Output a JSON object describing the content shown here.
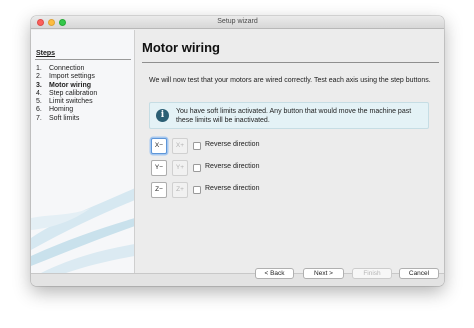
{
  "window": {
    "title": "Setup wizard"
  },
  "sidebar": {
    "heading": "Steps",
    "steps": [
      {
        "num": "1.",
        "label": "Connection",
        "active": false
      },
      {
        "num": "2.",
        "label": "Import settings",
        "active": false
      },
      {
        "num": "3.",
        "label": "Motor wiring",
        "active": true
      },
      {
        "num": "4.",
        "label": "Step calibration",
        "active": false
      },
      {
        "num": "5.",
        "label": "Limit switches",
        "active": false
      },
      {
        "num": "6.",
        "label": "Homing",
        "active": false
      },
      {
        "num": "7.",
        "label": "Soft limits",
        "active": false
      }
    ]
  },
  "main": {
    "title": "Motor wiring",
    "intro": "We will now test that your motors are wired correctly. Test each axis using the step buttons.",
    "info": {
      "icon": "info-icon",
      "text": "You have soft limits activated. Any button that would move the machine past these limits will be inactivated."
    },
    "axes": [
      {
        "minus": "X−",
        "plus": "X+",
        "reverse_label": "Reverse direction",
        "reverse_checked": false,
        "minus_focused": true
      },
      {
        "minus": "Y−",
        "plus": "Y+",
        "reverse_label": "Reverse direction",
        "reverse_checked": false,
        "minus_focused": false
      },
      {
        "minus": "Z−",
        "plus": "Z+",
        "reverse_label": "Reverse direction",
        "reverse_checked": false,
        "minus_focused": false
      }
    ]
  },
  "footer": {
    "back": "< Back",
    "next": "Next >",
    "finish": "Finish",
    "cancel": "Cancel",
    "finish_enabled": false
  },
  "colors": {
    "info_background": "#e4f2f6",
    "info_icon": "#2c5f74",
    "sidebar_swoosh": "#c9e1ec",
    "focus_ring": "#a6c8f0"
  }
}
